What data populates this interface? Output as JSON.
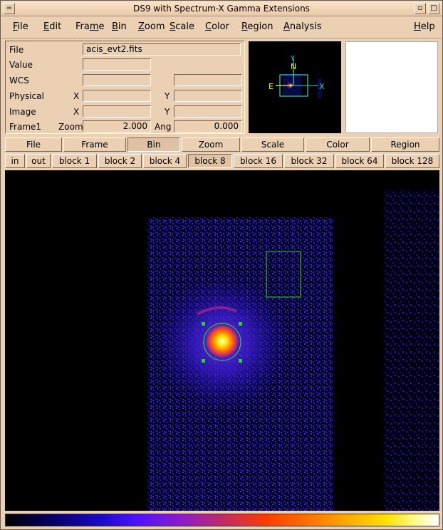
{
  "window": {
    "title": "DS9 with Spectrum-X Gamma Extensions"
  },
  "menubar": [
    {
      "label": "File",
      "u": "F",
      "rest": "ile"
    },
    {
      "label": "Edit",
      "u": "E",
      "rest": "dit"
    },
    {
      "label": "Frame",
      "pre": "Fra",
      "u": "m",
      "rest": "e"
    },
    {
      "label": "Bin",
      "u": "B",
      "rest": "in"
    },
    {
      "label": "Zoom",
      "u": "Z",
      "rest": "oom"
    },
    {
      "label": "Scale",
      "u": "S",
      "rest": "cale"
    },
    {
      "label": "Color",
      "u": "C",
      "rest": "olor"
    },
    {
      "label": "Region",
      "u": "R",
      "rest": "egion"
    },
    {
      "label": "Analysis",
      "u": "A",
      "rest": "nalysis"
    },
    {
      "label": "Help",
      "u": "H",
      "rest": "elp"
    }
  ],
  "info": {
    "file_label": "File",
    "file_value": "acis_evt2.fits",
    "value_label": "Value",
    "value": "",
    "wcs_label": "WCS",
    "wcs_a": "",
    "wcs_b": "",
    "physical_label": "Physical",
    "physical_x_label": "X",
    "physical_x": "",
    "physical_y_label": "Y",
    "physical_y": "",
    "image_label": "Image",
    "image_x_label": "X",
    "image_x": "",
    "image_y_label": "Y",
    "image_y": "",
    "frame_label": "Frame1",
    "zoom_label": "Zoom",
    "zoom": "2.000",
    "ang_label": "Ang",
    "ang": "0.000"
  },
  "panner": {
    "n": "N",
    "e": "E",
    "x": "X",
    "y": "Y"
  },
  "buttonbar": [
    "File",
    "Frame",
    "Bin",
    "Zoom",
    "Scale",
    "Color",
    "Region"
  ],
  "binbar": [
    "in",
    "out",
    "block 1",
    "block 2",
    "block 4",
    "block 8",
    "block 16",
    "block 32",
    "block 64",
    "block 128"
  ],
  "colors": {
    "region": "#1fd81f",
    "background": "#ecd0b4"
  }
}
